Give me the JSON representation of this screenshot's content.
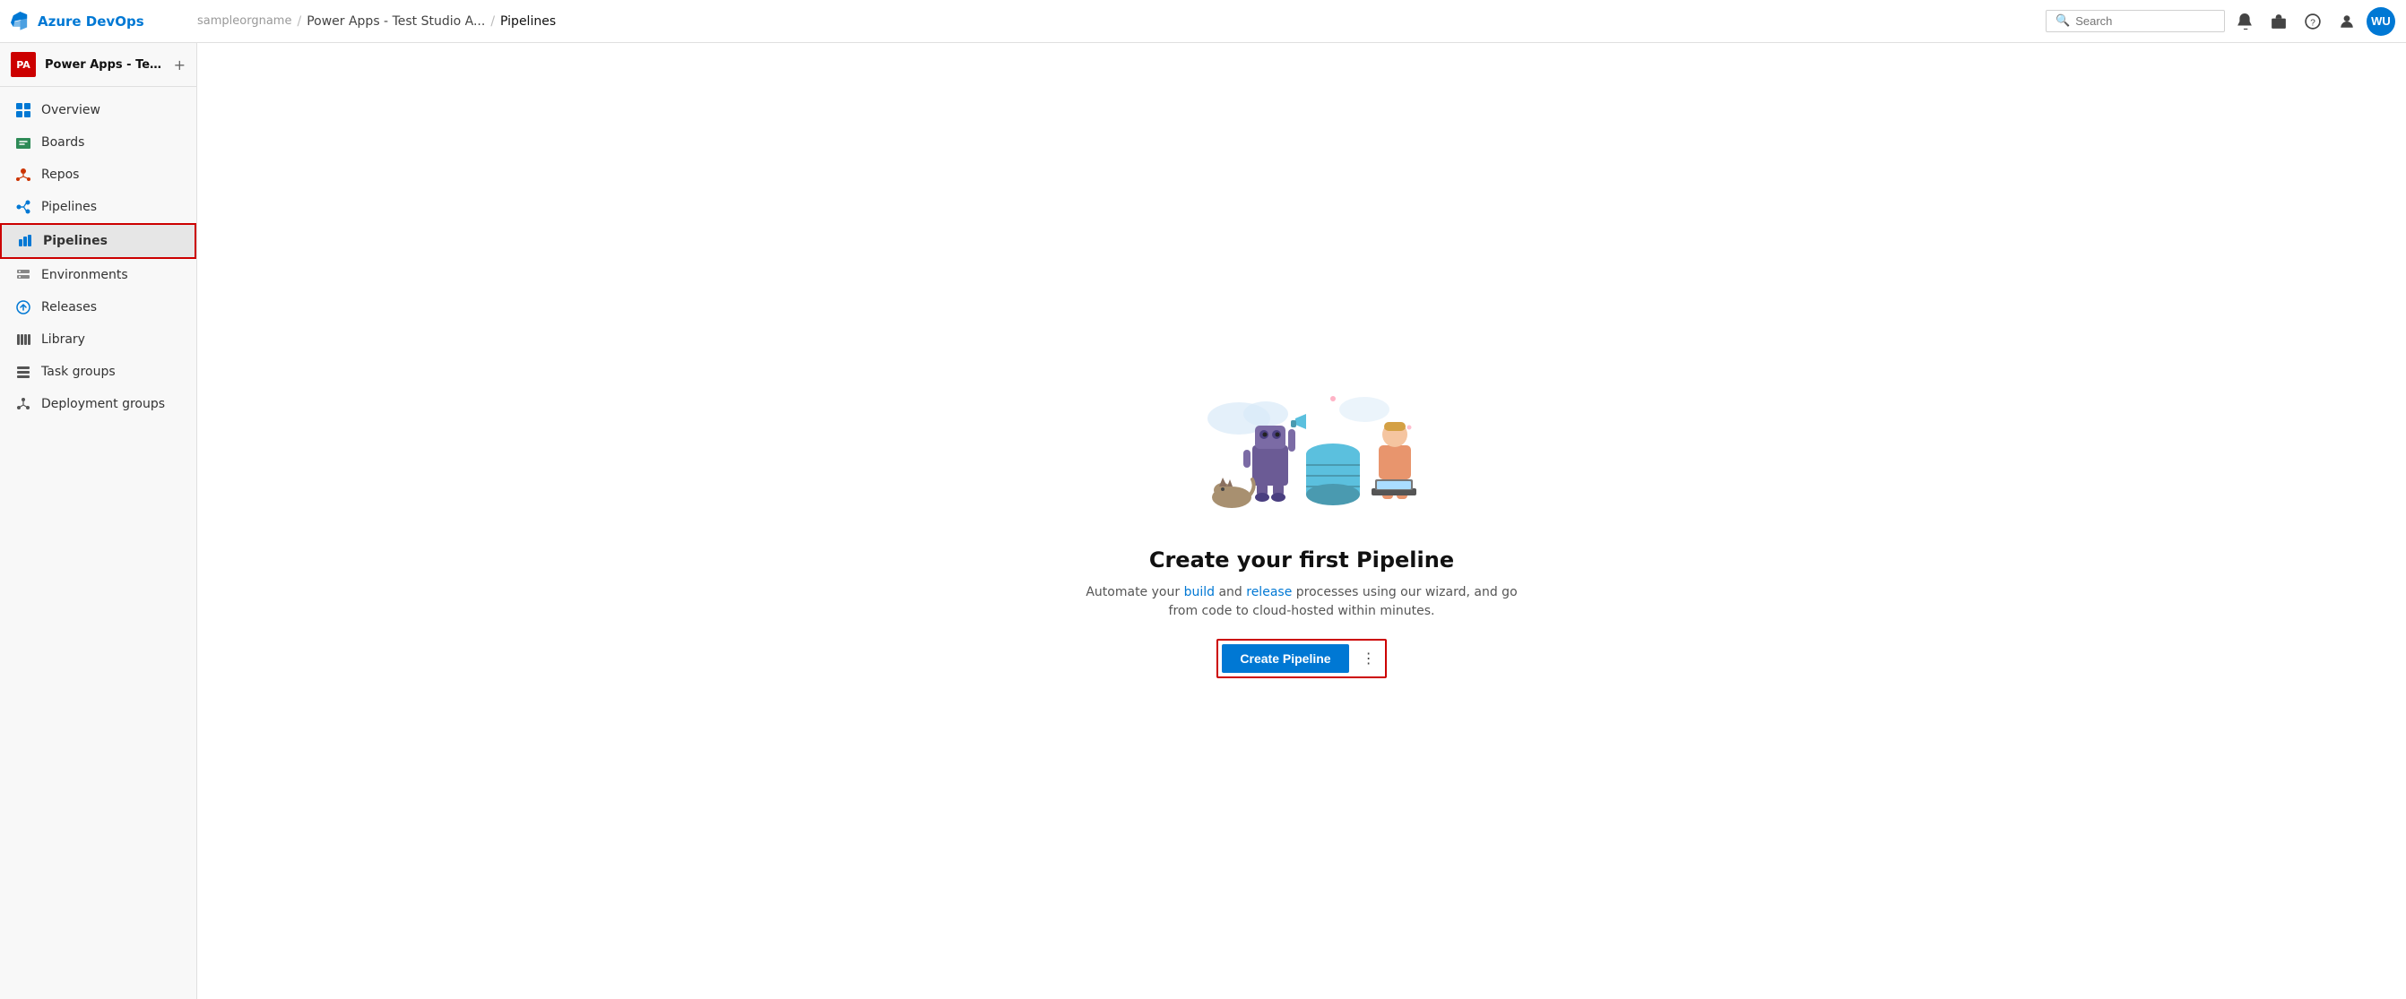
{
  "topbar": {
    "logo_text": "Azure DevOps",
    "breadcrumb_org": "sampleorgname",
    "sep1": "/",
    "breadcrumb_project": "Power Apps - Test Studio A...",
    "sep2": "/",
    "breadcrumb_current": "Pipelines",
    "search_placeholder": "Search",
    "search_label": "Search",
    "settings_icon": "⚙",
    "basket_icon": "🛍",
    "help_icon": "?",
    "user_icon": "👤",
    "avatar_initials": "WU"
  },
  "sidebar": {
    "project_initials": "PA",
    "project_name": "Power Apps - Test Stud...",
    "add_label": "+",
    "nav_items": [
      {
        "id": "overview",
        "label": "Overview",
        "icon": "overview"
      },
      {
        "id": "boards",
        "label": "Boards",
        "icon": "boards"
      },
      {
        "id": "repos",
        "label": "Repos",
        "icon": "repos"
      },
      {
        "id": "pipelines-parent",
        "label": "Pipelines",
        "icon": "pipelines",
        "section_header": true
      },
      {
        "id": "pipelines",
        "label": "Pipelines",
        "icon": "pipelines-sub",
        "active": true,
        "selected_outline": true
      },
      {
        "id": "environments",
        "label": "Environments",
        "icon": "environments"
      },
      {
        "id": "releases",
        "label": "Releases",
        "icon": "releases"
      },
      {
        "id": "library",
        "label": "Library",
        "icon": "library"
      },
      {
        "id": "task-groups",
        "label": "Task groups",
        "icon": "task-groups"
      },
      {
        "id": "deployment-groups",
        "label": "Deployment groups",
        "icon": "deployment-groups"
      }
    ]
  },
  "main": {
    "title": "Create your first Pipeline",
    "description_text": "Automate your build and release processes using our wizard, and go from code to cloud-hosted within minutes.",
    "description_link_build": "build",
    "description_link_release": "release",
    "create_button_label": "Create Pipeline",
    "more_options_label": "⋮"
  }
}
